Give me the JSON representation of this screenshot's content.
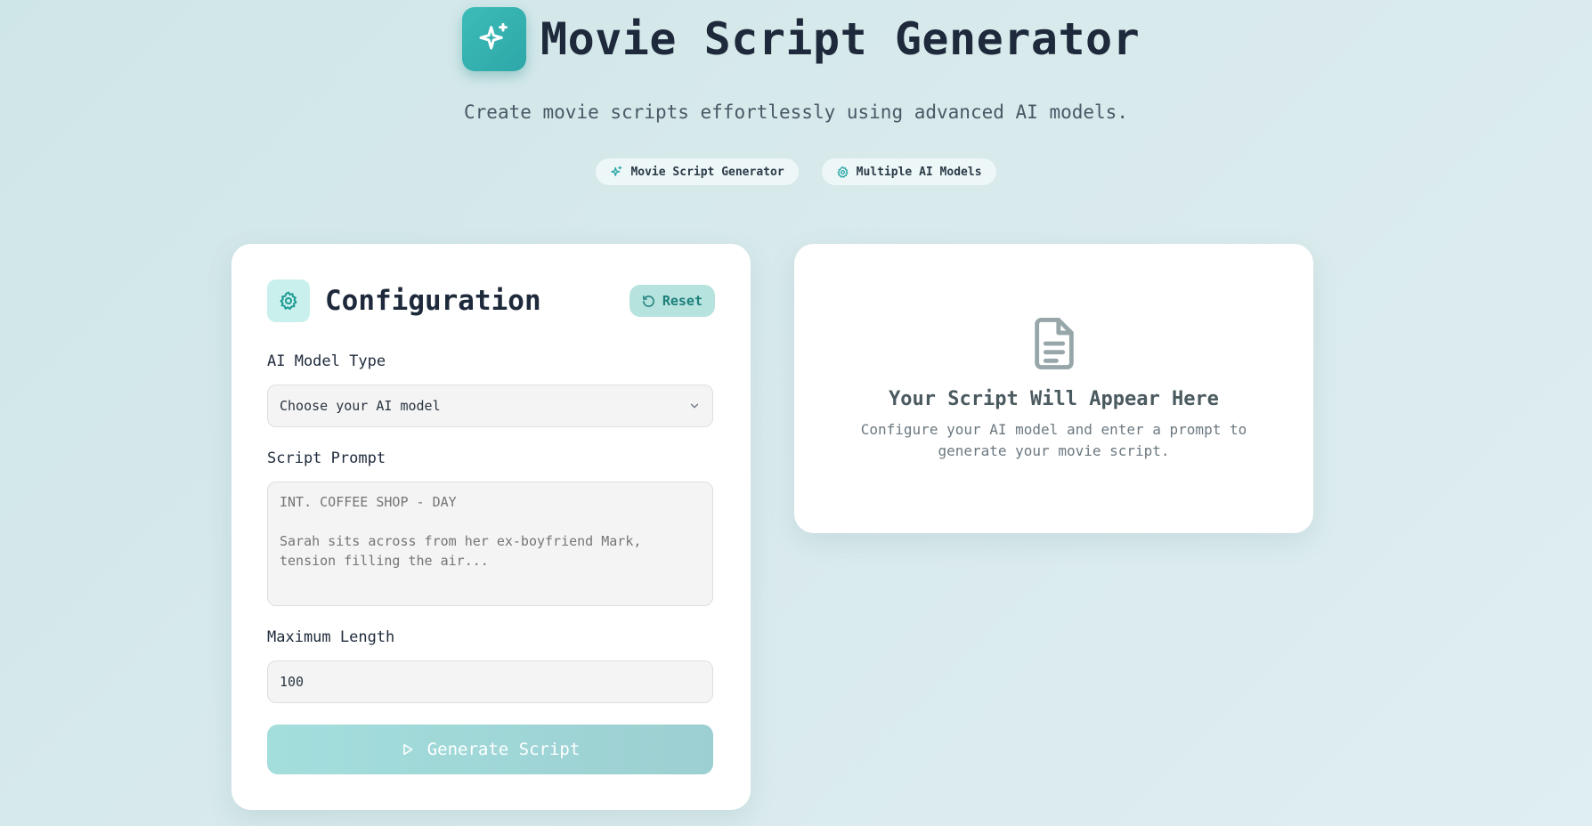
{
  "header": {
    "title": "Movie Script Generator",
    "subtitle": "Create movie scripts effortlessly using advanced AI models.",
    "pills": [
      {
        "label": "Movie Script Generator",
        "icon": "sparkles-icon"
      },
      {
        "label": "Multiple AI Models",
        "icon": "gear-icon"
      }
    ]
  },
  "config": {
    "title": "Configuration",
    "reset_label": "Reset",
    "model_label": "AI Model Type",
    "model_value": "Choose your AI model",
    "prompt_label": "Script Prompt",
    "prompt_placeholder": "INT. COFFEE SHOP - DAY\n\nSarah sits across from her ex-boyfriend Mark, tension filling the air...",
    "length_label": "Maximum Length",
    "length_value": "100",
    "generate_label": "Generate Script"
  },
  "output": {
    "title": "Your Script Will Appear Here",
    "description": "Configure your AI model and enter a prompt to generate your movie script."
  },
  "colors": {
    "accent": "#2ea7a8",
    "accent_light": "#c9f0ed",
    "button_disabled": "#a3dedd"
  }
}
